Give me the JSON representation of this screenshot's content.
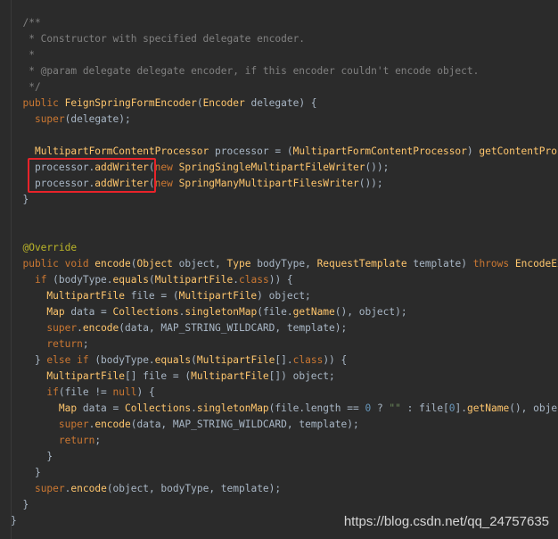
{
  "code": {
    "lines": [
      [
        {
          "t": "  /**",
          "c": "cm"
        }
      ],
      [
        {
          "t": "   * Constructor with specified delegate encoder.",
          "c": "cm"
        }
      ],
      [
        {
          "t": "   *",
          "c": "cm"
        }
      ],
      [
        {
          "t": "   * @param delegate delegate encoder, if this encoder couldn't encode object.",
          "c": "cm"
        }
      ],
      [
        {
          "t": "   */",
          "c": "cm"
        }
      ],
      [
        {
          "t": "  public ",
          "c": "kw"
        },
        {
          "t": "FeignSpringFormEncoder",
          "c": "fn"
        },
        {
          "t": "(",
          "c": "plain"
        },
        {
          "t": "Encoder",
          "c": "tp"
        },
        {
          "t": " delegate) {",
          "c": "plain"
        }
      ],
      [
        {
          "t": "    ",
          "c": "plain"
        },
        {
          "t": "super",
          "c": "kw"
        },
        {
          "t": "(delegate);",
          "c": "plain"
        }
      ],
      [
        {
          "t": "",
          "c": "plain"
        }
      ],
      [
        {
          "t": "    ",
          "c": "plain"
        },
        {
          "t": "MultipartFormContentProcessor",
          "c": "tp"
        },
        {
          "t": " processor = (",
          "c": "plain"
        },
        {
          "t": "MultipartFormContentProcessor",
          "c": "tp"
        },
        {
          "t": ") ",
          "c": "plain"
        },
        {
          "t": "getContentProcessor(MULTIPART);",
          "c": "fn"
        }
      ],
      [
        {
          "t": "    processor.",
          "c": "plain"
        },
        {
          "t": "addWriter",
          "c": "fn"
        },
        {
          "t": "(",
          "c": "plain"
        },
        {
          "t": "new ",
          "c": "kw"
        },
        {
          "t": "SpringSingleMultipartFileWriter",
          "c": "tp"
        },
        {
          "t": "());",
          "c": "plain"
        }
      ],
      [
        {
          "t": "    processor.",
          "c": "plain"
        },
        {
          "t": "addWriter",
          "c": "fn"
        },
        {
          "t": "(",
          "c": "plain"
        },
        {
          "t": "new ",
          "c": "kw"
        },
        {
          "t": "SpringManyMultipartFilesWriter",
          "c": "tp"
        },
        {
          "t": "());",
          "c": "plain"
        }
      ],
      [
        {
          "t": "  }",
          "c": "plain"
        }
      ],
      [
        {
          "t": "",
          "c": "plain"
        }
      ],
      [
        {
          "t": "",
          "c": "plain"
        }
      ],
      [
        {
          "t": "  @Override",
          "c": "ann"
        }
      ],
      [
        {
          "t": "  public void ",
          "c": "kw"
        },
        {
          "t": "encode",
          "c": "fn"
        },
        {
          "t": "(",
          "c": "plain"
        },
        {
          "t": "Object",
          "c": "tp"
        },
        {
          "t": " object, ",
          "c": "plain"
        },
        {
          "t": "Type",
          "c": "tp"
        },
        {
          "t": " bodyType, ",
          "c": "plain"
        },
        {
          "t": "RequestTemplate",
          "c": "tp"
        },
        {
          "t": " template) ",
          "c": "plain"
        },
        {
          "t": "throws ",
          "c": "kw"
        },
        {
          "t": "EncodeException {",
          "c": "tp"
        }
      ],
      [
        {
          "t": "    ",
          "c": "plain"
        },
        {
          "t": "if",
          "c": "kw"
        },
        {
          "t": " (bodyType.",
          "c": "plain"
        },
        {
          "t": "equals",
          "c": "fn"
        },
        {
          "t": "(",
          "c": "plain"
        },
        {
          "t": "MultipartFile",
          "c": "tp"
        },
        {
          "t": ".",
          "c": "plain"
        },
        {
          "t": "class",
          "c": "kw"
        },
        {
          "t": ")) {",
          "c": "plain"
        }
      ],
      [
        {
          "t": "      ",
          "c": "plain"
        },
        {
          "t": "MultipartFile",
          "c": "tp"
        },
        {
          "t": " file = (",
          "c": "plain"
        },
        {
          "t": "MultipartFile",
          "c": "tp"
        },
        {
          "t": ") object;",
          "c": "plain"
        }
      ],
      [
        {
          "t": "      ",
          "c": "plain"
        },
        {
          "t": "Map",
          "c": "tp"
        },
        {
          "t": " data = ",
          "c": "plain"
        },
        {
          "t": "Collections",
          "c": "tp"
        },
        {
          "t": ".",
          "c": "plain"
        },
        {
          "t": "singletonMap",
          "c": "fn"
        },
        {
          "t": "(file.",
          "c": "plain"
        },
        {
          "t": "getName",
          "c": "fn"
        },
        {
          "t": "(), object);",
          "c": "plain"
        }
      ],
      [
        {
          "t": "      ",
          "c": "plain"
        },
        {
          "t": "super",
          "c": "kw"
        },
        {
          "t": ".",
          "c": "plain"
        },
        {
          "t": "encode",
          "c": "fn"
        },
        {
          "t": "(data, MAP_STRING_WILDCARD, template);",
          "c": "plain"
        }
      ],
      [
        {
          "t": "      ",
          "c": "plain"
        },
        {
          "t": "return",
          "c": "kw"
        },
        {
          "t": ";",
          "c": "plain"
        }
      ],
      [
        {
          "t": "    } ",
          "c": "plain"
        },
        {
          "t": "else if",
          "c": "kw"
        },
        {
          "t": " (bodyType.",
          "c": "plain"
        },
        {
          "t": "equals",
          "c": "fn"
        },
        {
          "t": "(",
          "c": "plain"
        },
        {
          "t": "MultipartFile",
          "c": "tp"
        },
        {
          "t": "[].",
          "c": "plain"
        },
        {
          "t": "class",
          "c": "kw"
        },
        {
          "t": ")) {",
          "c": "plain"
        }
      ],
      [
        {
          "t": "      ",
          "c": "plain"
        },
        {
          "t": "MultipartFile",
          "c": "tp"
        },
        {
          "t": "[] file = (",
          "c": "plain"
        },
        {
          "t": "MultipartFile",
          "c": "tp"
        },
        {
          "t": "[]) object;",
          "c": "plain"
        }
      ],
      [
        {
          "t": "      ",
          "c": "plain"
        },
        {
          "t": "if",
          "c": "kw"
        },
        {
          "t": "(file != ",
          "c": "plain"
        },
        {
          "t": "null",
          "c": "kw"
        },
        {
          "t": ") {",
          "c": "plain"
        }
      ],
      [
        {
          "t": "        ",
          "c": "plain"
        },
        {
          "t": "Map",
          "c": "tp"
        },
        {
          "t": " data = ",
          "c": "plain"
        },
        {
          "t": "Collections",
          "c": "tp"
        },
        {
          "t": ".",
          "c": "plain"
        },
        {
          "t": "singletonMap",
          "c": "fn"
        },
        {
          "t": "(file.length == ",
          "c": "plain"
        },
        {
          "t": "0",
          "c": "num"
        },
        {
          "t": " ? ",
          "c": "plain"
        },
        {
          "t": "\"\"",
          "c": "str"
        },
        {
          "t": " : file[",
          "c": "plain"
        },
        {
          "t": "0",
          "c": "num"
        },
        {
          "t": "].",
          "c": "plain"
        },
        {
          "t": "getName",
          "c": "fn"
        },
        {
          "t": "(), object);",
          "c": "plain"
        }
      ],
      [
        {
          "t": "        ",
          "c": "plain"
        },
        {
          "t": "super",
          "c": "kw"
        },
        {
          "t": ".",
          "c": "plain"
        },
        {
          "t": "encode",
          "c": "fn"
        },
        {
          "t": "(data, MAP_STRING_WILDCARD, template);",
          "c": "plain"
        }
      ],
      [
        {
          "t": "        ",
          "c": "plain"
        },
        {
          "t": "return",
          "c": "kw"
        },
        {
          "t": ";",
          "c": "plain"
        }
      ],
      [
        {
          "t": "      }",
          "c": "plain"
        }
      ],
      [
        {
          "t": "    }",
          "c": "plain"
        }
      ],
      [
        {
          "t": "    ",
          "c": "plain"
        },
        {
          "t": "super",
          "c": "kw"
        },
        {
          "t": ".",
          "c": "plain"
        },
        {
          "t": "encode",
          "c": "fn"
        },
        {
          "t": "(object, bodyType, template);",
          "c": "plain"
        }
      ],
      [
        {
          "t": "  }",
          "c": "plain"
        }
      ],
      [
        {
          "t": "}",
          "c": "plain"
        }
      ]
    ]
  },
  "highlight": {
    "color": "#e8232a",
    "covers_lines": [
      9,
      10
    ]
  },
  "watermark": {
    "text": "https://blog.csdn.net/qq_24757635"
  },
  "theme": {
    "background": "#2b2b2b",
    "keyword": "#cc7832",
    "type": "#ffc66d",
    "comment": "#808080",
    "annotation": "#bbb529",
    "default": "#a9b7c6"
  }
}
